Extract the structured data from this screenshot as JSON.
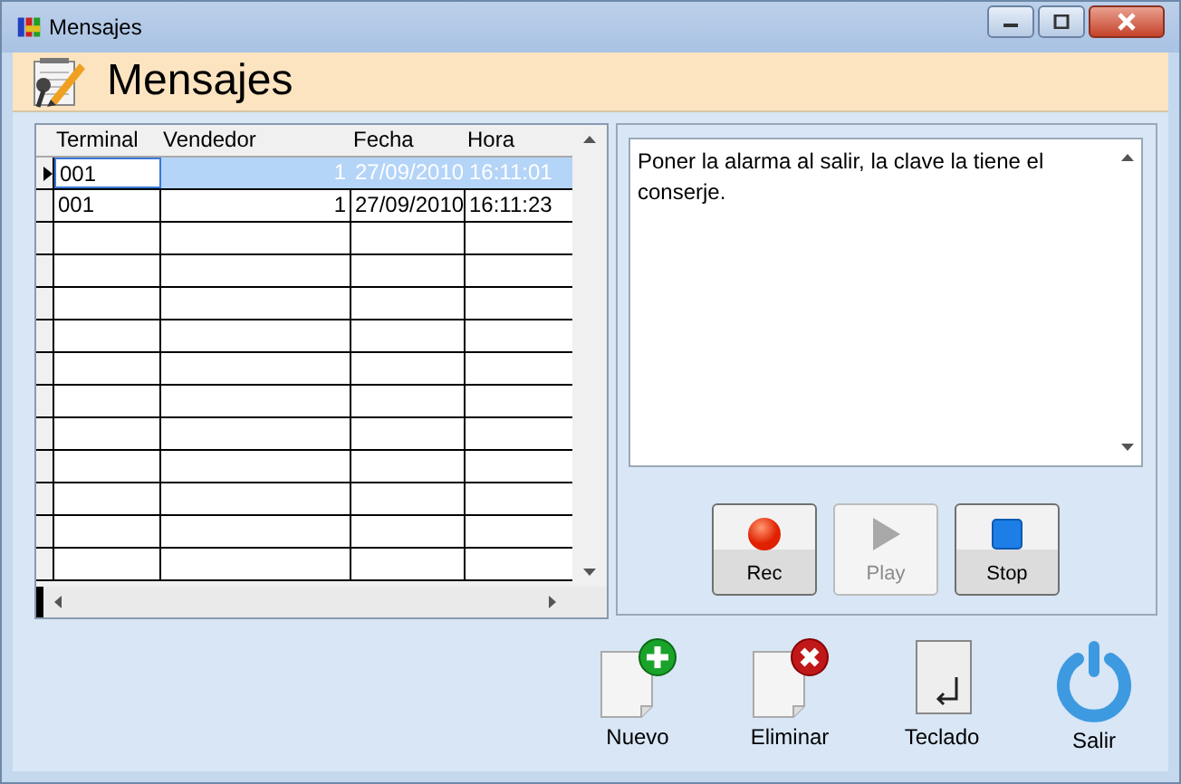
{
  "window": {
    "title": "Mensajes"
  },
  "header": {
    "title": "Mensajes"
  },
  "table": {
    "columns": [
      "Terminal",
      "Vendedor",
      "Fecha",
      "Hora"
    ],
    "rows": [
      {
        "terminal": "001",
        "vendedor": "1",
        "fecha": "27/09/2010",
        "hora": "16:11:01",
        "selected": true
      },
      {
        "terminal": "001",
        "vendedor": "1",
        "fecha": "27/09/2010",
        "hora": "16:11:23",
        "selected": false
      }
    ]
  },
  "message": {
    "value": "Poner la alarma al salir, la clave la tiene el conserje."
  },
  "media_buttons": [
    {
      "kind": "rec",
      "label": "Rec",
      "disabled": false
    },
    {
      "kind": "play",
      "label": "Play",
      "disabled": true
    },
    {
      "kind": "stop",
      "label": "Stop",
      "disabled": false
    }
  ],
  "actions": [
    {
      "kind": "new",
      "label": "Nuevo"
    },
    {
      "kind": "delete",
      "label": "Eliminar"
    },
    {
      "kind": "keyboard",
      "label": "Teclado"
    },
    {
      "kind": "exit",
      "label": "Salir"
    }
  ]
}
